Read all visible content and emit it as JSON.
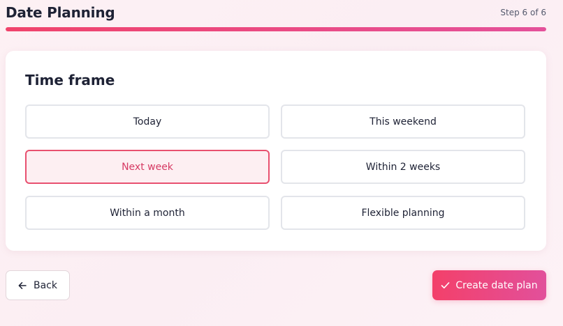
{
  "header": {
    "title": "Date Planning",
    "step": "Step 6 of 6",
    "progress_fraction": 1.0
  },
  "question": {
    "title": "Time frame",
    "selected": "Next week",
    "options": [
      {
        "label": "Today"
      },
      {
        "label": "This weekend"
      },
      {
        "label": "Next week"
      },
      {
        "label": "Within 2 weeks"
      },
      {
        "label": "Within a month"
      },
      {
        "label": "Flexible planning"
      }
    ]
  },
  "footer": {
    "back_label": "Back",
    "back_icon": "arrow-left-icon",
    "submit_label": "Create date plan",
    "submit_icon": "check-icon"
  },
  "colors": {
    "accent": "#f0436b",
    "accent_end": "#e4519a",
    "selected_border": "#e8506f",
    "selected_background": "#fdeff2",
    "selected_text": "#d63a63"
  }
}
